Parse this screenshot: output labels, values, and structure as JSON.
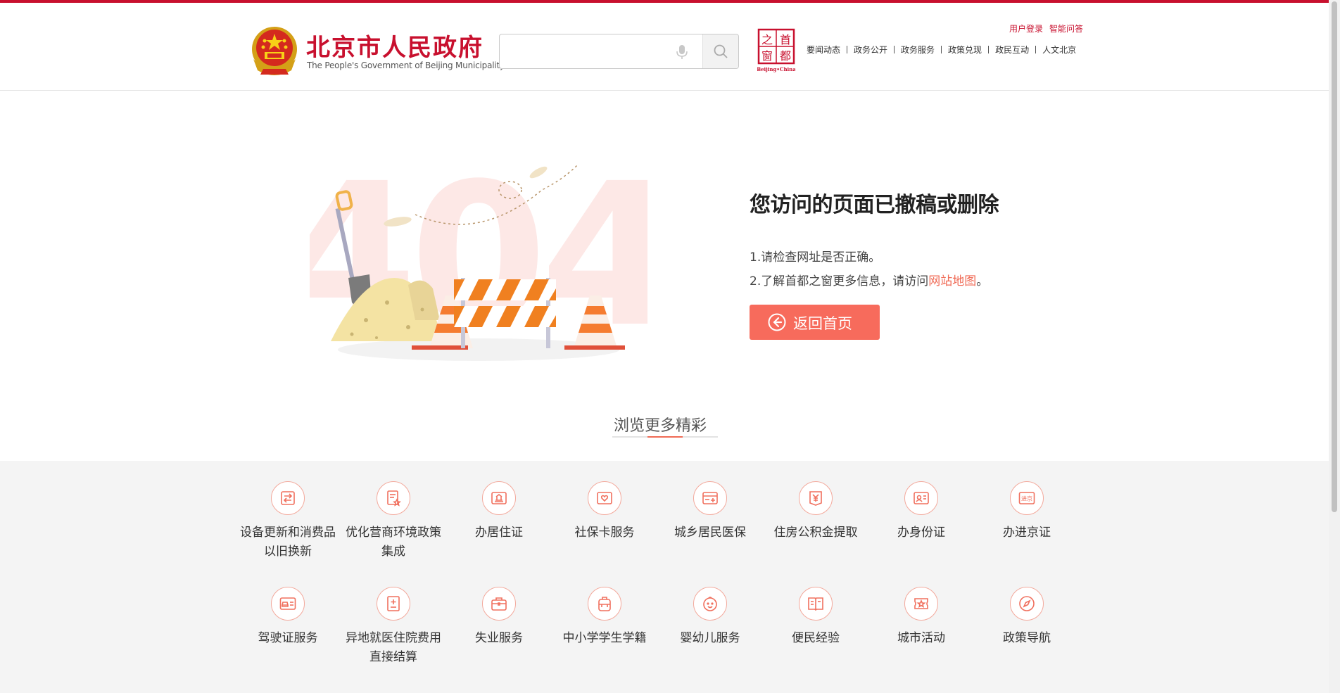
{
  "header": {
    "logo_cn": "北京市人民政府",
    "logo_en": "The People's Government of Beijing Municipality",
    "search_placeholder": "",
    "capital_logo_text": "首都之窗",
    "capital_logo_sub": "Beijing•China",
    "top_links": [
      "用户登录",
      "智能问答"
    ],
    "nav": [
      "要闻动态",
      "政务公开",
      "政务服务",
      "政策兑现",
      "政民互动",
      "人文北京"
    ]
  },
  "error": {
    "illustration_number": "404",
    "title": "您访问的页面已撤稿或删除",
    "line1": "1.请检查网址是否正确。",
    "line2_prefix": "2.了解首都之窗更多信息，请访问",
    "line2_link": "网站地图",
    "line2_suffix": "。",
    "home_button": "返回首页"
  },
  "browse": {
    "title": "浏览更多精彩",
    "services": [
      {
        "label": "设备更新和消费品以旧换新",
        "icon": "exchange-icon"
      },
      {
        "label": "优化营商环境政策集成",
        "icon": "policy-doc-icon"
      },
      {
        "label": "办居住证",
        "icon": "residence-icon"
      },
      {
        "label": "社保卡服务",
        "icon": "social-card-icon"
      },
      {
        "label": "城乡居民医保",
        "icon": "medical-card-icon"
      },
      {
        "label": "住房公积金提取",
        "icon": "housing-fund-icon"
      },
      {
        "label": "办身份证",
        "icon": "id-card-icon"
      },
      {
        "label": "办进京证",
        "icon": "entry-permit-icon"
      },
      {
        "label": "驾驶证服务",
        "icon": "driver-license-icon"
      },
      {
        "label": "异地就医住院费用直接结算",
        "icon": "hospital-settlement-icon"
      },
      {
        "label": "失业服务",
        "icon": "briefcase-icon"
      },
      {
        "label": "中小学学生学籍",
        "icon": "backpack-icon"
      },
      {
        "label": "婴幼儿服务",
        "icon": "baby-icon"
      },
      {
        "label": "便民经验",
        "icon": "book-icon"
      },
      {
        "label": "城市活动",
        "icon": "ticket-icon"
      },
      {
        "label": "政策导航",
        "icon": "compass-icon"
      }
    ]
  },
  "colors": {
    "brand_red": "#c8102e",
    "accent": "#f76b5c",
    "link": "#f06a55",
    "gray_bg": "#f4f4f4"
  }
}
